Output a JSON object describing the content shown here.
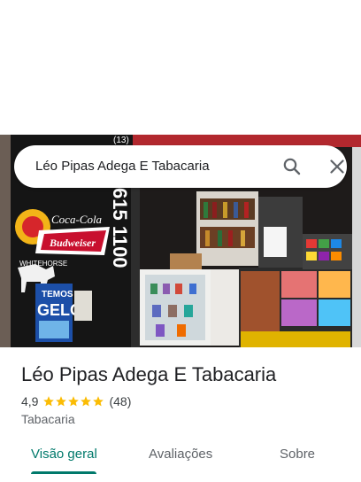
{
  "search": {
    "query": "Léo Pipas Adega E Tabacaria"
  },
  "place": {
    "name": "Léo Pipas Adega E Tabacaria",
    "rating": "4,9",
    "stars": 5,
    "review_count": "(48)",
    "category": "Tabacaria"
  },
  "photo": {
    "sign_phone": "615 1100",
    "sign_top": "(13)",
    "brand_cocacola": "Coca-Cola",
    "brand_budweiser": "Budweiser",
    "brand_whitehorse": "WHITEHORSE",
    "sign_temos": "TEMOS",
    "sign_gelo": "GELO"
  },
  "tabs": [
    {
      "label": "Visão geral",
      "active": true
    },
    {
      "label": "Avaliações",
      "active": false
    },
    {
      "label": "Sobre",
      "active": false
    }
  ],
  "colors": {
    "accent": "#00796b",
    "star": "#fbbc04"
  }
}
